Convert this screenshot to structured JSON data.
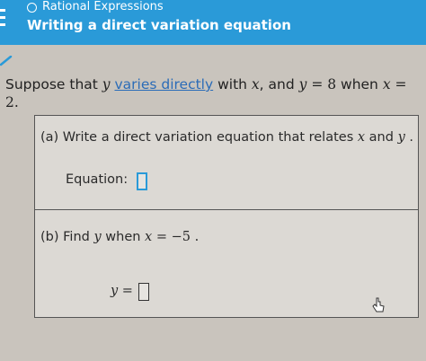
{
  "header": {
    "chapter": "Rational Expressions",
    "lesson": "Writing a direct variation equation"
  },
  "problem": {
    "prefix": "Suppose that ",
    "var_y": "y",
    "link_text": "varies directly",
    "mid": " with ",
    "var_x": "x",
    "and": ", and ",
    "equation": " = 8",
    "when": " when ",
    "equation2": " = 2."
  },
  "part_a": {
    "question_prefix": "(a) Write a direct variation equation that relates ",
    "var_x": "x",
    "and": " and ",
    "var_y": "y",
    "suffix": " .",
    "equation_label": "Equation:",
    "equation_value": ""
  },
  "part_b": {
    "question_prefix": "(b) Find ",
    "var_y": "y",
    "when": " when ",
    "var_x": "x",
    "condition": " = −5 .",
    "answer_var": "y",
    "answer_eq": " =",
    "answer_value": ""
  },
  "colors": {
    "header_bg": "#2a9ad8",
    "link": "#2b6cb8",
    "check": "#2a9ad8"
  }
}
